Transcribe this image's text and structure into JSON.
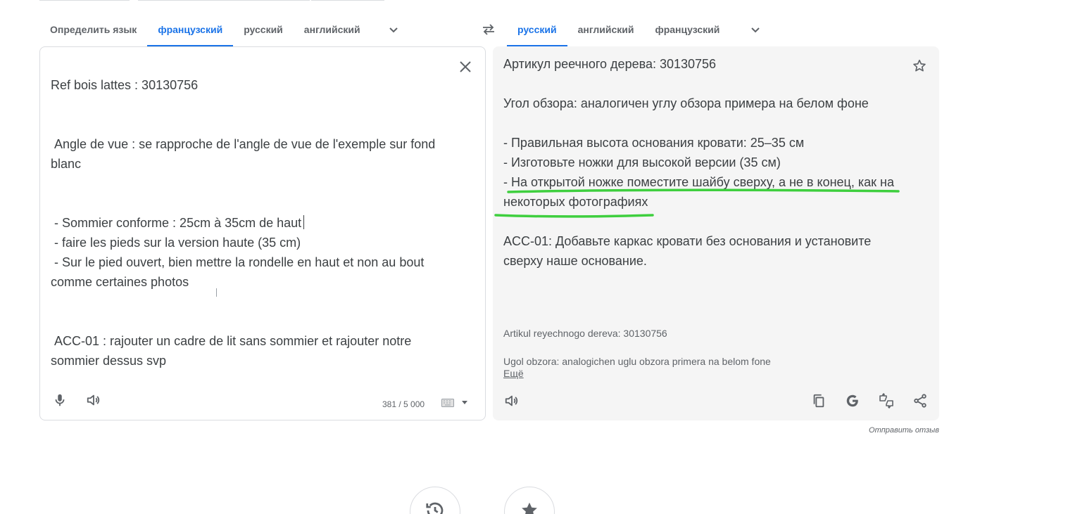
{
  "source_langs": {
    "tabs": [
      "Определить язык",
      "французский",
      "русский",
      "английский"
    ],
    "active_index": 1
  },
  "target_langs": {
    "tabs": [
      "русский",
      "английский",
      "французский"
    ],
    "active_index": 0
  },
  "source": {
    "lines": [
      "Ref bois lattes : 30130756",
      "",
      "",
      " Angle de vue : se rapproche de l'angle de vue de l'exemple sur fond blanc",
      "",
      "",
      " - Sommier conforme : 25cm à 35cm de haut",
      " - faire les pieds sur la version haute (35 cm)",
      " - Sur le pied ouvert, bien mettre la rondelle en haut et non au bout comme certaines photos",
      "",
      "",
      " ACC-01 : rajouter un cadre de lit sans sommier et rajouter notre sommier dessus svp"
    ],
    "char_count": "381 / 5 000"
  },
  "target": {
    "lines": [
      "Артикул реечного дерева: 30130756",
      "",
      "Угол обзора: аналогичен углу обзора примера на белом фоне",
      "",
      "- Правильная высота основания кровати: 25–35 см",
      "- Изготовьте ножки для высокой версии (35 см)",
      "- На открытой ножке поместите шайбу сверху, а не в конец, как на некоторых фотографиях",
      "",
      "ACC-01: Добавьте каркас кровати без основания и установите сверху наше основание."
    ],
    "transliteration": [
      "Artikul reyechnogo dereva: 30130756",
      "",
      "Ugol obzora: analogichen uglu obzora primera na belom fone"
    ],
    "more_label": "Ещё"
  },
  "feedback_label": "Отправить отзыв",
  "colors": {
    "accent": "#1a73e8",
    "annotation": "#3ecf3e",
    "target_bg": "#f5f5f5"
  },
  "icons": [
    "swap-icon",
    "close-icon",
    "microphone-icon",
    "speaker-icon",
    "keyboard-icon",
    "star-icon",
    "copy-icon",
    "google-icon",
    "feedback-icon",
    "share-icon",
    "history-icon",
    "saved-icon"
  ]
}
